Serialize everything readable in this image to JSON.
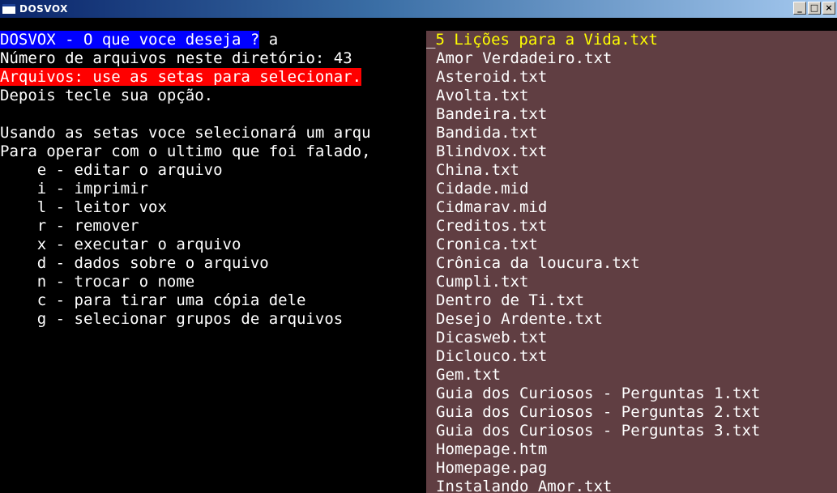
{
  "window": {
    "title": "DOSVOX",
    "controls": {
      "minimize": "_",
      "maximize": "□",
      "close": "×"
    }
  },
  "prompt": {
    "question": "DOSVOX - O que voce deseja ?",
    "typed": "a"
  },
  "left_lines": [
    "Número de arquivos neste diretório: 43",
    "Arquivos: use as setas para selecionar.",
    "Depois tecle sua opção.",
    "",
    "Usando as setas voce selecionará um arqu",
    "Para operar com o ultimo que foi falado,",
    "    e - editar o arquivo",
    "    i - imprimir",
    "    l - leitor vox",
    "    r - remover",
    "    x - executar o arquivo",
    "    d - dados sobre o arquivo",
    "    n - trocar o nome",
    "    c - para tirar uma cópia dele",
    "    g - selecionar grupos de arquivos"
  ],
  "file_list": {
    "cursor": "_",
    "selected_index": 0,
    "items": [
      "5 Lições para a Vida.txt",
      "Amor Verdadeiro.txt",
      "Asteroid.txt",
      "Avolta.txt",
      "Bandeira.txt",
      "Bandida.txt",
      "Blindvox.txt",
      "China.txt",
      "Cidade.mid",
      "Cidmarav.mid",
      "Creditos.txt",
      "Cronica.txt",
      "Crônica da loucura.txt",
      "Cumpli.txt",
      "Dentro de Ti.txt",
      "Desejo Ardente.txt",
      "Dicasweb.txt",
      "Diclouco.txt",
      "Gem.txt",
      "Guia dos Curiosos - Perguntas 1.txt",
      "Guia dos Curiosos - Perguntas 2.txt",
      "Guia dos Curiosos - Perguntas 3.txt",
      "Homepage.htm",
      "Homepage.pag",
      "Instalando Amor.txt"
    ]
  },
  "colors": {
    "screen_bg": "#000000",
    "list_bg": "#603e42",
    "prompt_highlight": "#0000ff",
    "warning_highlight": "#ff0000",
    "selected_text": "#ffff00"
  }
}
